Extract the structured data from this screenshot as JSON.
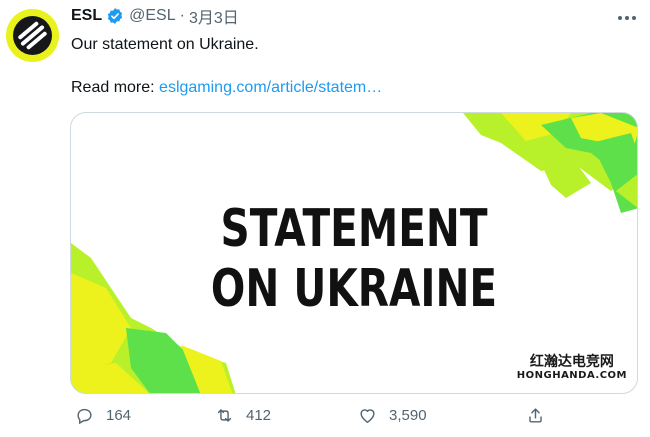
{
  "tweet": {
    "author_name": "ESL",
    "handle": "@ESL",
    "separator": "·",
    "date": "3月3日",
    "text": "Our statement on Ukraine.",
    "read_more_label": "Read more:",
    "link_text": "eslgaming.com/article/statem…"
  },
  "card": {
    "title_line1": "STATEMENT",
    "title_line2": "ON UKRAINE",
    "watermark_line1": "红瀚达电竞网",
    "watermark_line2": "HONGHANDA.COM",
    "colors": {
      "green": "#5ee04a",
      "yellow": "#eef21c",
      "lime": "#b8f02a"
    }
  },
  "actions": {
    "reply_count": "164",
    "retweet_count": "412",
    "like_count": "3,590"
  },
  "icons": [
    "verified-badge-icon",
    "more-icon",
    "reply-icon",
    "retweet-icon",
    "like-icon",
    "share-icon"
  ],
  "colors": {
    "accent": "#1d9bf0",
    "muted": "#536471",
    "avatar_ring": "#e9f21a"
  }
}
